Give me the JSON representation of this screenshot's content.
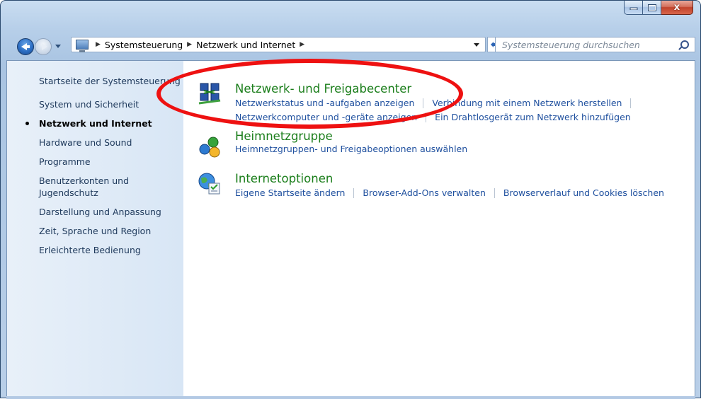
{
  "window": {
    "caption_buttons": {
      "minimize_icon": "minimize-icon",
      "maximize_icon": "maximize-icon",
      "close_glyph": "x"
    }
  },
  "nav": {
    "breadcrumbs": [
      "Systemsteuerung",
      "Netzwerk und Internet"
    ],
    "search_placeholder": "Systemsteuerung durchsuchen"
  },
  "sidebar": {
    "items": [
      {
        "label": "Startseite der Systemsteuerung",
        "active": false
      },
      {
        "label": "System und Sicherheit",
        "active": false
      },
      {
        "label": "Netzwerk und Internet",
        "active": true
      },
      {
        "label": "Hardware und Sound",
        "active": false
      },
      {
        "label": "Programme",
        "active": false
      },
      {
        "label": "Benutzerkonten und Jugendschutz",
        "active": false
      },
      {
        "label": "Darstellung und Anpassung",
        "active": false
      },
      {
        "label": "Zeit, Sprache und Region",
        "active": false
      },
      {
        "label": "Erleichterte Bedienung",
        "active": false
      }
    ]
  },
  "categories": [
    {
      "title": "Netzwerk- und Freigabecenter",
      "icon": "network-center-icon",
      "links": [
        [
          "Netzwerkstatus und -aufgaben anzeigen",
          "Verbindung mit einem Netzwerk herstellen"
        ],
        [
          "Netzwerkcomputer und -geräte anzeigen",
          "Ein Drahtlosgerät zum Netzwerk hinzufügen"
        ]
      ]
    },
    {
      "title": "Heimnetzgruppe",
      "icon": "homegroup-icon",
      "links": [
        [
          "Heimnetzgruppen- und Freigabeoptionen auswählen"
        ]
      ]
    },
    {
      "title": "Internetoptionen",
      "icon": "internet-options-icon",
      "links": [
        [
          "Eigene Startseite ändern",
          "Browser-Add-Ons verwalten",
          "Browserverlauf und Cookies löschen"
        ]
      ]
    }
  ],
  "colors": {
    "link": "#1e4f9e",
    "category_title": "#1b7e1b",
    "annotation": "#ee1111"
  }
}
